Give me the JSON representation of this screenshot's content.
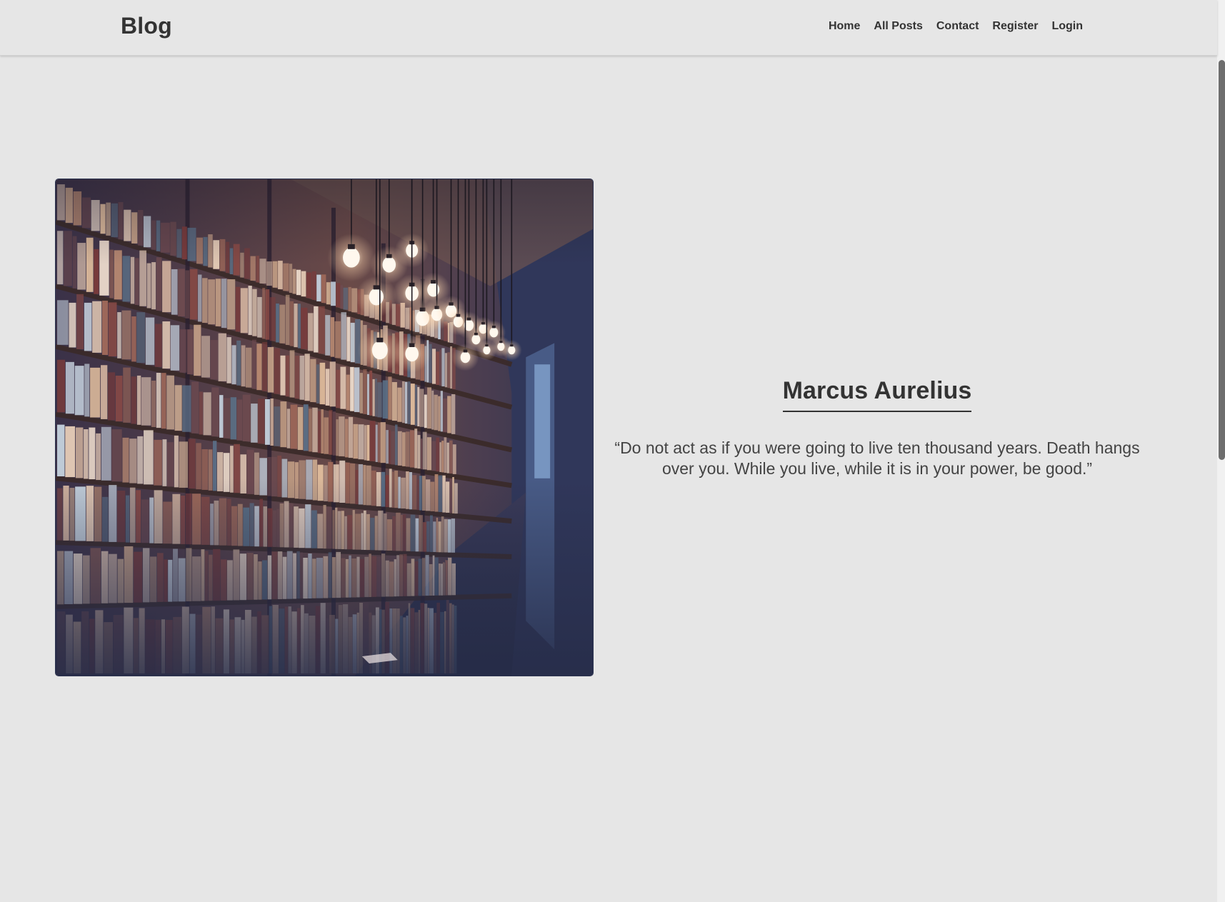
{
  "header": {
    "brand": "Blog",
    "nav": [
      {
        "label": "Home"
      },
      {
        "label": "All Posts"
      },
      {
        "label": "Contact"
      },
      {
        "label": "Register"
      },
      {
        "label": "Login"
      }
    ]
  },
  "hero": {
    "image_subject": "library-bookshelves-with-hanging-lightbulbs",
    "author": "Marcus Aurelius",
    "quote": "“Do not act as if you were going to live ten thousand years. Death hangs over you. While you live, while it is in your power, be good.”"
  },
  "colors": {
    "background": "#e6e6e6",
    "text": "#333333",
    "image_shadow_tone": "#2f3654",
    "bulb_glow": "#fff6e6"
  }
}
